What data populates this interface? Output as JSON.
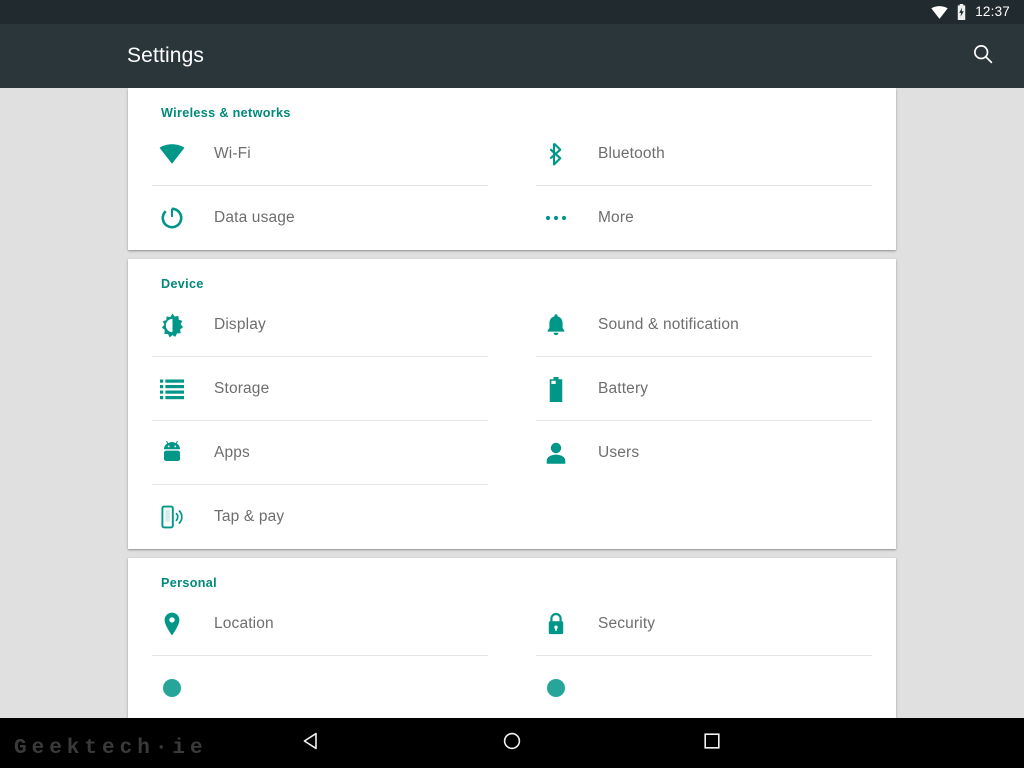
{
  "status_bar": {
    "time": "12:37",
    "icons": [
      "wifi-icon",
      "battery-charging-icon"
    ]
  },
  "app_bar": {
    "title": "Settings",
    "search_icon": "search-icon"
  },
  "theme": {
    "accent": "#009688",
    "section_header": "#00897b",
    "appbar_bg": "#2b363b",
    "statusbar_bg": "#212a2e",
    "page_bg": "#e0e0e0",
    "card_bg": "#ffffff",
    "label_color": "#6e6e6e",
    "divider": "#e4e4e4",
    "navbar_bg": "#000000"
  },
  "sections": [
    {
      "title": "Wireless & networks",
      "rows": [
        [
          {
            "label": "Wi-Fi",
            "icon": "wifi-icon"
          },
          {
            "label": "Bluetooth",
            "icon": "bluetooth-icon"
          }
        ],
        [
          {
            "label": "Data usage",
            "icon": "data-usage-icon"
          },
          {
            "label": "More",
            "icon": "more-horizontal-icon"
          }
        ]
      ]
    },
    {
      "title": "Device",
      "rows": [
        [
          {
            "label": "Display",
            "icon": "brightness-icon"
          },
          {
            "label": "Sound & notification",
            "icon": "bell-icon"
          }
        ],
        [
          {
            "label": "Storage",
            "icon": "storage-list-icon"
          },
          {
            "label": "Battery",
            "icon": "battery-icon"
          }
        ],
        [
          {
            "label": "Apps",
            "icon": "android-robot-icon"
          },
          {
            "label": "Users",
            "icon": "person-icon"
          }
        ],
        [
          {
            "label": "Tap & pay",
            "icon": "tap-and-pay-icon"
          },
          {
            "label": "",
            "icon": ""
          }
        ]
      ]
    },
    {
      "title": "Personal",
      "rows": [
        [
          {
            "label": "Location",
            "icon": "location-pin-icon"
          },
          {
            "label": "Security",
            "icon": "lock-icon"
          }
        ]
      ]
    }
  ],
  "nav_bar": {
    "back": "back-triangle-icon",
    "home": "home-circle-icon",
    "recents": "recents-square-icon"
  },
  "watermark": "Geektech·ie"
}
